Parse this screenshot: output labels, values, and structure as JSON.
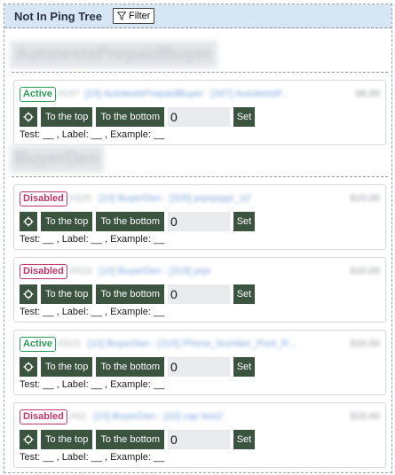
{
  "header": {
    "title": "Not In Ping Tree",
    "filter_label": "Filter"
  },
  "groups": [
    {
      "title": "AutotestsPrepaidBuyer",
      "cards": [
        {
          "status": "Active",
          "status_type": "active",
          "id": "#247",
          "link": "[23] AutotestsPrepaidBuyer : [347] AutotestsP...",
          "price": "$6.00",
          "position": "0",
          "meta": "Test: __ , Label: __ , Example: __"
        }
      ]
    },
    {
      "title": "BuyerDen",
      "cards": [
        {
          "status": "Disabled",
          "status_type": "disabled",
          "id": "#325:",
          "link": "[10] BuyerDen : [325] prprprppr_10",
          "price": "$10.00",
          "position": "0",
          "meta": "Test: __ , Label: __ , Example: __"
        },
        {
          "status": "Disabled",
          "status_type": "disabled",
          "id": "#319:",
          "link": "[10] BuyerDen : [319] prpr",
          "price": "$10.00",
          "position": "0",
          "meta": "Test: __ , Label: __ , Example: __"
        },
        {
          "status": "Active",
          "status_type": "active",
          "id": "#315:",
          "link": "[10] BuyerDen : [315] Phone_Number_Pool_R...",
          "price": "$10.00",
          "position": "0",
          "meta": "Test: __ , Label: __ , Example: __"
        },
        {
          "status": "Disabled",
          "status_type": "disabled",
          "id": "#42:",
          "link": "[10] BuyerDen : [42] cap test2",
          "price": "$10.00",
          "position": "0",
          "meta": "Test: __ , Label: __ , Example: __"
        }
      ]
    }
  ],
  "buttons": {
    "top": "To the top",
    "bottom": "To the bottom",
    "set": "Set"
  },
  "icons": {
    "filter": "filter-icon",
    "target": "crosshair-icon"
  },
  "colors": {
    "active": "#2e9a59",
    "disabled": "#c0366b",
    "button": "#3b5440",
    "header_bg": "#d7e6f4"
  }
}
